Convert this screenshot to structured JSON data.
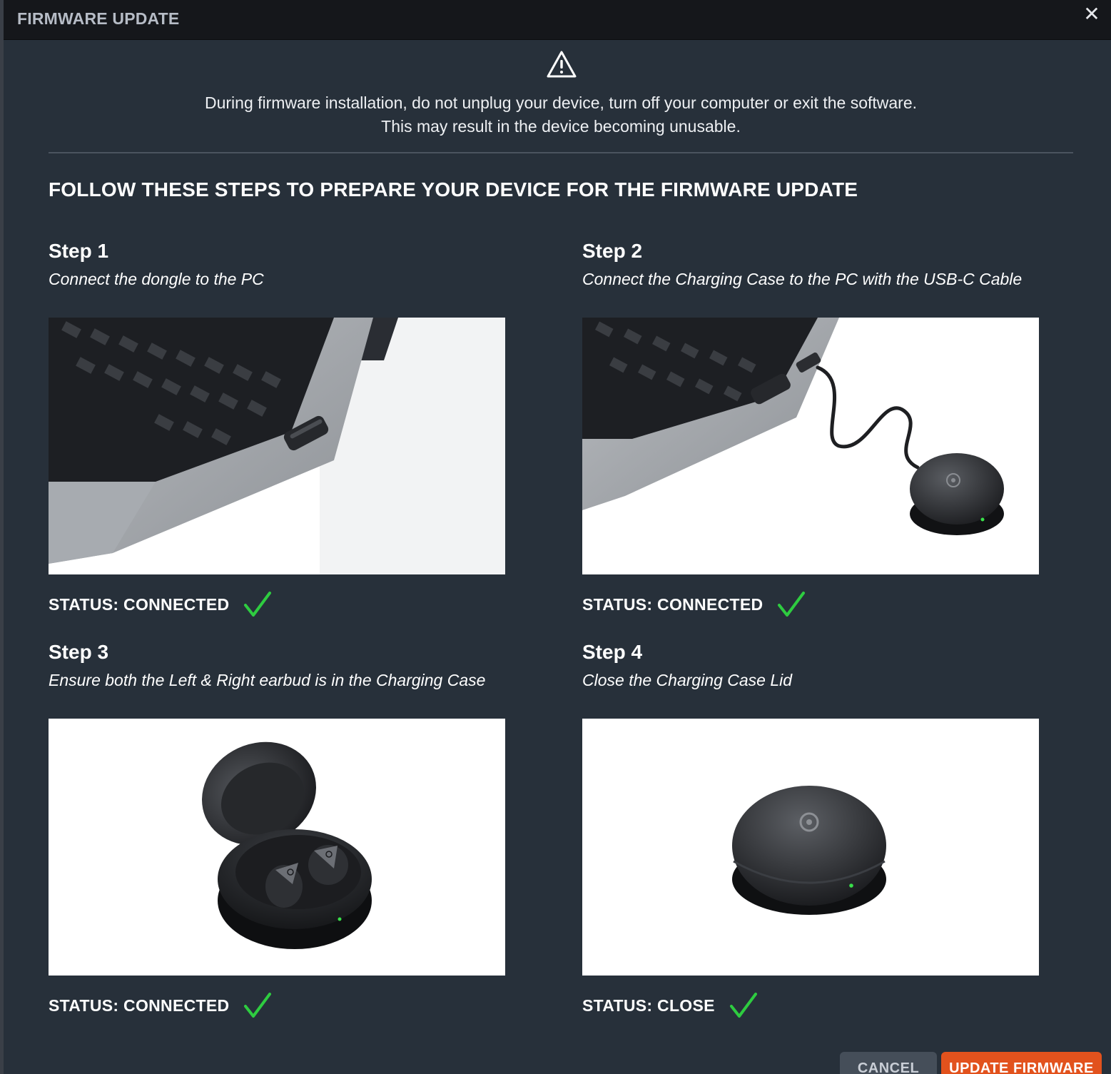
{
  "dialog": {
    "title": "FIRMWARE UPDATE",
    "close_icon": "close-icon",
    "warning_icon": "warning-triangle-icon",
    "warning_text": "During firmware installation, do not unplug your device, turn off your computer or exit the software. This may result in the device becoming unusable.",
    "heading": "FOLLOW THESE STEPS TO PREPARE YOUR DEVICE FOR THE FIRMWARE UPDATE"
  },
  "steps": [
    {
      "title": "Step 1",
      "description": "Connect the dongle to the PC",
      "image": "laptop-with-dongle",
      "status": "STATUS: CONNECTED",
      "check_icon": "checkmark-icon"
    },
    {
      "title": "Step 2",
      "description": "Connect the Charging Case to the PC with the USB-C Cable",
      "image": "laptop-with-charging-case-cable",
      "status": "STATUS: CONNECTED",
      "check_icon": "checkmark-icon"
    },
    {
      "title": "Step 3",
      "description": "Ensure both the Left & Right earbud is in the Charging Case",
      "image": "open-case-with-earbuds",
      "status": "STATUS: CONNECTED",
      "check_icon": "checkmark-icon"
    },
    {
      "title": "Step 4",
      "description": "Close the Charging Case Lid",
      "image": "closed-charging-case",
      "status": "STATUS: CLOSE",
      "check_icon": "checkmark-icon"
    }
  ],
  "footer": {
    "cancel_label": "CANCEL",
    "update_label": "UPDATE FIRMWARE"
  },
  "colors": {
    "dialog_bg": "#27303a",
    "titlebar_bg": "#15171b",
    "check_green": "#2ecc40",
    "update_button": "#e2521d",
    "cancel_button": "#454e59"
  }
}
